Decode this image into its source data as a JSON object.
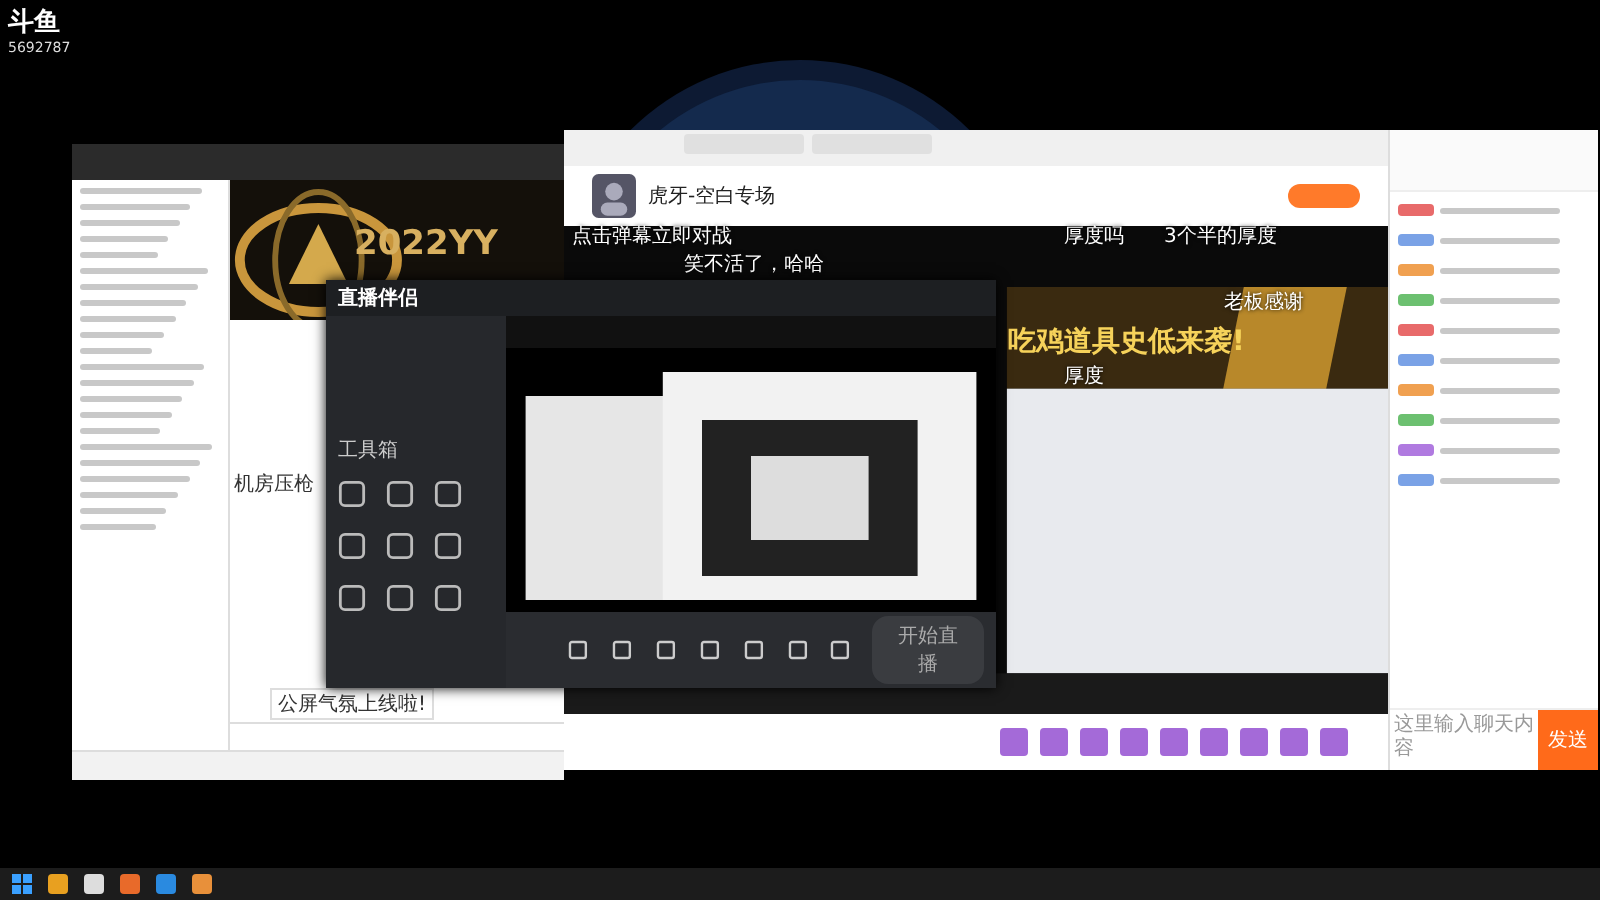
{
  "logo": {
    "brand": "斗鱼",
    "room": "5692787"
  },
  "yy_window": {
    "banner": "2022YY",
    "chat_line": "机房压枪",
    "notice": "公屏气氛上线啦!"
  },
  "companion": {
    "brand": "直播伴侣",
    "toolbox": "工具箱",
    "start_button": "开始直播"
  },
  "browser": {
    "streamer": "虎牙-空白专场",
    "banner": "吃鸡道具史低来袭!",
    "danmaku": [
      {
        "text": "点击弹幕立即对战"
      },
      {
        "text": "厚度吗"
      },
      {
        "text": "3个半的厚度"
      },
      {
        "text": "笑不活了，哈哈"
      },
      {
        "text": "老板感谢"
      },
      {
        "text": "厚度"
      }
    ]
  },
  "chat_panel": {
    "placeholder": "这里输入聊天内容",
    "send": "发送"
  }
}
